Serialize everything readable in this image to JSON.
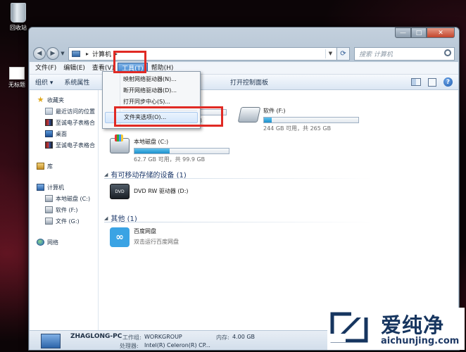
{
  "desktop": {
    "icons": [
      {
        "label": "回收站"
      },
      {
        "label": "无标题"
      }
    ]
  },
  "window": {
    "controls": {
      "minimize": "—",
      "maximize": "□",
      "close": "✕"
    },
    "address": {
      "path_label": "计算机",
      "search_placeholder": "搜索 计算机"
    },
    "menubar": {
      "items": [
        "文件(F)",
        "编辑(E)",
        "查看(V)",
        "工具(T)",
        "帮助(H)"
      ],
      "active_index": 3
    },
    "toolbar": {
      "items": [
        "组织 ▾",
        "系统属性",
        "打开控制面板"
      ]
    },
    "tools_menu": {
      "items": [
        "映射网络驱动器(N)...",
        "断开网络驱动器(D)...",
        "打开同步中心(S)...",
        "文件夹选项(O)..."
      ],
      "hover_index": 3
    },
    "nav": {
      "favorites": {
        "header": "收藏夹",
        "items": [
          "最近访问的位置",
          "至诚电子表格合",
          "桌面",
          "至诚电子表格合"
        ]
      },
      "libraries": {
        "header": "库"
      },
      "computer": {
        "header": "计算机",
        "items": [
          "本地磁盘 (C:)",
          "软件 (F:)",
          "文件 (G:)"
        ]
      },
      "network": {
        "header": "网络"
      }
    },
    "sections": {
      "hard_disks_visible": "硬",
      "removable": "有可移动存储的设备 (1)",
      "other": "其他 (1)"
    },
    "drives": [
      {
        "name": "",
        "info": "44.4 GB 可用，共 99.9 GB",
        "fill": 0.56
      },
      {
        "name": "软件 (F:)",
        "info": "244 GB 可用，共 265 GB",
        "fill": 0.08
      },
      {
        "name": "本地磁盘 (C:)",
        "info": "62.7 GB 可用，共 99.9 GB",
        "fill": 0.37
      }
    ],
    "dvd": {
      "name": "DVD RW 驱动器 (D:)",
      "icon_text": "DVD"
    },
    "other_item": {
      "name": "百度网盘",
      "sub": "双击运行百度网盘"
    },
    "status": {
      "pc_name": "ZHAGLONG-PC",
      "workgroup_label": "工作组:",
      "workgroup": "WORKGROUP",
      "memory_label": "内存:",
      "memory": "4.00 GB",
      "processor_label": "处理器:",
      "processor": "Intel(R) Celeron(R) CP..."
    }
  },
  "watermark": {
    "cn": "爱纯净",
    "url": "aichunjing.com"
  },
  "colors": {
    "highlight": "#e02a24",
    "drive_fill": "#1c8fcb",
    "watermark_text": "#16355f"
  }
}
